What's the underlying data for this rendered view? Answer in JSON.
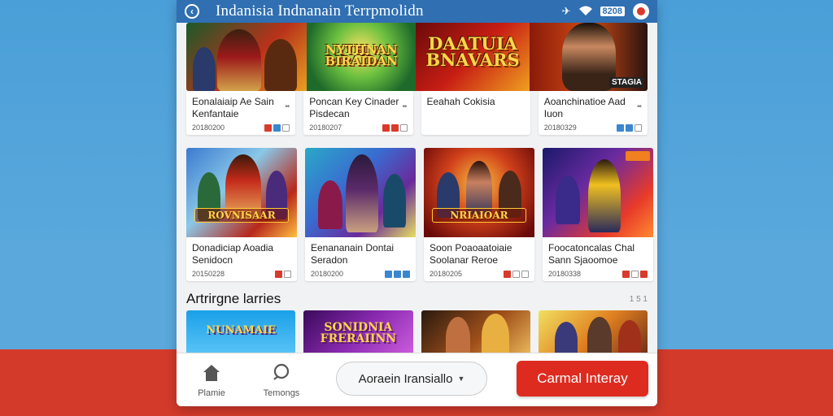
{
  "app": {
    "title": "Indanisia Indnanain Terrpmolidn",
    "status_badge": "8208"
  },
  "banners": {
    "b2_logo": "NYTHNAN BIRAIDAN",
    "b3_logo": "DAATUIA BNAVARS",
    "b3_tag": "STAGIA"
  },
  "row1": [
    {
      "title": "Eonalaiaip Ae Sain Kenfantaie",
      "date": "20180200"
    },
    {
      "title": "Poncan Key Cinader Pisdecan",
      "date": "20180207"
    },
    {
      "title": "Eeahah Cokisia",
      "date": ""
    },
    {
      "title": "Aoanchinatioe Aad Iuon",
      "date": "20180329"
    }
  ],
  "row2": [
    {
      "title": "Donadiciap Aoadia Senidocn",
      "date": "20150228",
      "logo": "ROVNISAAR"
    },
    {
      "title": "Eenananain Dontai Seradon",
      "date": "20180200",
      "logo": ""
    },
    {
      "title": "Soon Poaoaatoiaie Soolanar Reroe",
      "date": "20180205",
      "logo": "NRIAIOAR"
    },
    {
      "title": "Foocatoncalas Chal Sann Sjaoomoe",
      "date": "20180338",
      "logo": ""
    }
  ],
  "section": {
    "heading": "Artrirgne larries",
    "more": "1 5 1"
  },
  "bottom_thumbs": [
    {
      "logo": "NUNAMAIE"
    },
    {
      "logo": "SONIDNIA FRERAIINN"
    },
    {
      "logo": ""
    },
    {
      "logo": ""
    }
  ],
  "nav": {
    "home_label": "Plamie",
    "settings_label": "Temongs",
    "dropdown_label": "Aoraein Iransiallo",
    "cta_label": "Carmal Interay"
  },
  "colors": {
    "topbar": "#2f6fb2",
    "cta": "#de2b20"
  }
}
